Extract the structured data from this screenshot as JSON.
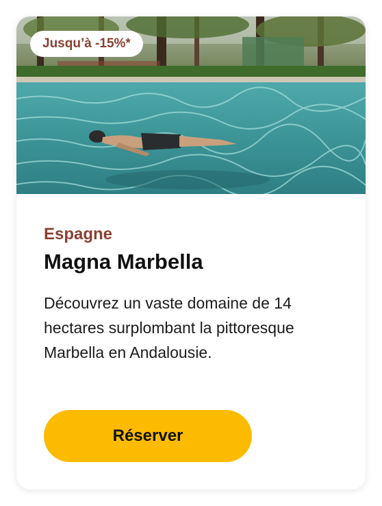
{
  "card": {
    "badge": "Jusqu’à -15%*",
    "image_alt": "swimming-pool-photo",
    "country": "Espagne",
    "title": "Magna Marbella",
    "description": "Découvrez un vaste domaine de 14 hectares surplombant la pittoresque Marbella en Andalousie.",
    "cta_label": "Réserver"
  },
  "colors": {
    "accent": "#8a4032",
    "button": "#fdbb00",
    "pool": "#3f9a9c"
  }
}
